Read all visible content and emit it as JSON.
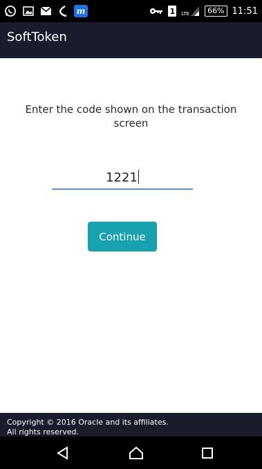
{
  "status_bar": {
    "icons_left": [
      "whatsapp-icon",
      "image-icon",
      "mail-icon",
      "missed-call-icon",
      "app-m-icon"
    ],
    "app_m_label": "m",
    "sim_label": "1",
    "network_label": "LTE",
    "battery": "66%",
    "time": "11:51"
  },
  "app_bar": {
    "title": "SoftToken"
  },
  "main": {
    "prompt_line1": "Enter the code shown on the transaction",
    "prompt_line2": "screen",
    "code_value": "1221",
    "continue_label": "Continue"
  },
  "footer": {
    "copyright": "Copyright © 2016 Oracle and its affiliates.",
    "rights": "All rights reserved."
  },
  "nav_bar": {
    "buttons": [
      "back-icon",
      "home-icon",
      "recents-icon"
    ]
  },
  "colors": {
    "app_bar": "#1a1c2c",
    "button": "#17a2b0",
    "underline": "#5b8fd6"
  }
}
